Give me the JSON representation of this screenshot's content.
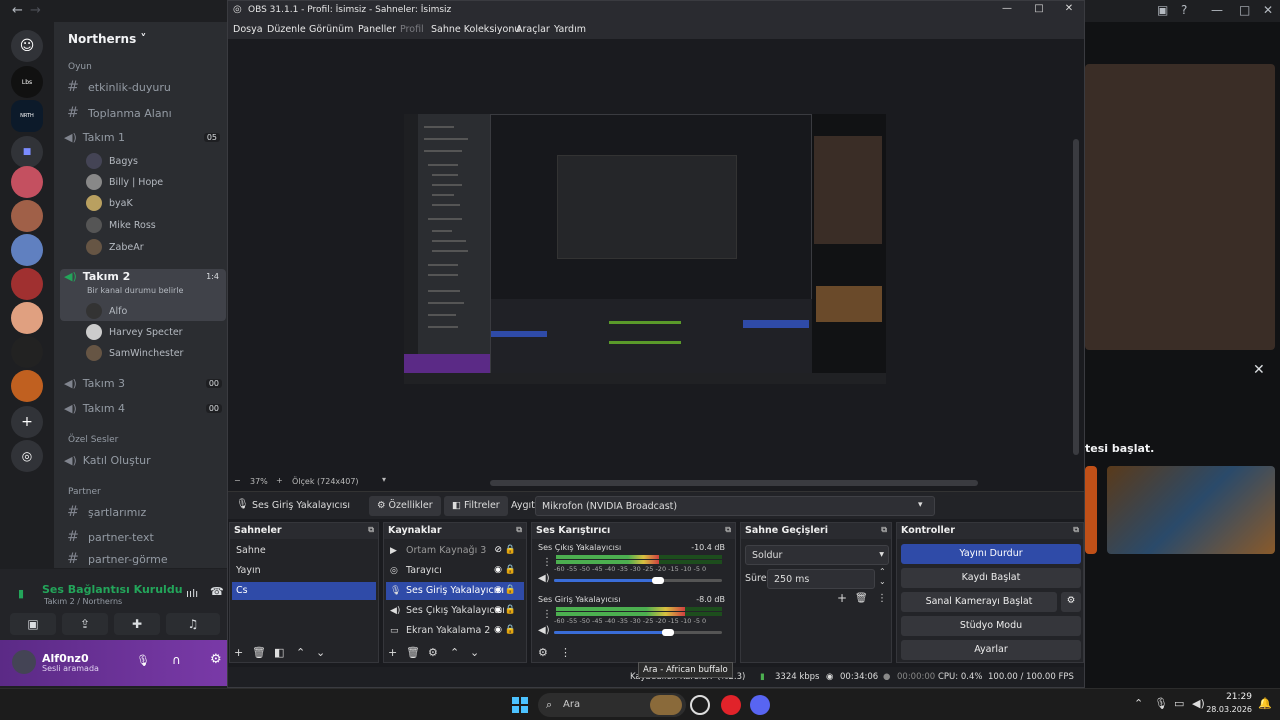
{
  "discord": {
    "server_name": "Northerns",
    "categories": {
      "oyun": "Oyun",
      "ozel_sesler": "Özel Sesler",
      "partner": "Partner"
    },
    "channels": {
      "etkinlik": "etkinlik-duyuru",
      "toplanma": "Toplanma Alanı",
      "takim1": "Takım 1",
      "takim2": "Takım 2",
      "takim2_status": "Bir kanal durumu belirle",
      "takim3": "Takım 3",
      "takim4": "Takım 4",
      "katil": "Katıl Oluştur",
      "sartlar": "şartlarımız",
      "partner_text": "partner-text",
      "partner_gorme": "partner-görme"
    },
    "badges": {
      "takim1": "05",
      "takim3": "00",
      "takim4": "00",
      "takim2_time": "1:4"
    },
    "takim1_users": [
      "Bagys",
      "Billy | Hope",
      "byaK",
      "Mike Ross",
      "ZabeAr"
    ],
    "takim2_users": [
      "Alfo",
      "Harvey Specter",
      "SamWinchester"
    ],
    "voice": {
      "status": "Ses Bağlantısı Kuruldu",
      "where": "Takım 2 / Northerns"
    },
    "user": {
      "name": "Alf0nz0",
      "status": "Sesli aramada"
    }
  },
  "right": {
    "text": "tesi başlat."
  },
  "obs": {
    "title": "OBS 31.1.1 - Profil: İsimsiz - Sahneler: İsimsiz",
    "menu": [
      "Dosya",
      "Düzenle",
      "Görünüm",
      "Paneller",
      "Profil",
      "Sahne Koleksiyonu",
      "Araçlar",
      "Yardım"
    ],
    "zoom": {
      "minus": "−",
      "value": "37%",
      "plus": "+",
      "scale": "Ölçek (724x407)"
    },
    "source_bar": {
      "name": "Ses Giriş Yakalayıcısı",
      "properties": "Özellikler",
      "filters": "Filtreler",
      "device_label": "Aygıt",
      "device_value": "Mikrofon (NVIDIA Broadcast)"
    },
    "scenes": {
      "title": "Sahneler",
      "items": [
        "Sahne",
        "Yayın",
        "Cs"
      ]
    },
    "sources": {
      "title": "Kaynaklar",
      "items": [
        "Ortam Kaynağı 3",
        "Tarayıcı",
        "Ses Giriş Yakalayıcısı",
        "Ses Çıkış Yakalayıcısı",
        "Ekran Yakalama 2"
      ]
    },
    "mixer": {
      "title": "Ses Karıştırıcı",
      "scale": "-60 -55 -50 -45 -40 -35 -30 -25 -20 -15 -10 -5 0",
      "channels": [
        {
          "name": "Ses Çıkış Yakalayıcısı",
          "db": "-10.4 dB",
          "level": 0.62,
          "volume": 0.62
        },
        {
          "name": "Ses Giriş Yakalayıcısı",
          "db": "-8.0 dB",
          "level": 0.78,
          "volume": 0.68
        }
      ]
    },
    "transitions": {
      "title": "Sahne Geçişleri",
      "type": "Soldur",
      "duration_label": "Süre",
      "duration": "250 ms"
    },
    "controls": {
      "title": "Kontroller",
      "stop_stream": "Yayını Durdur",
      "start_record": "Kaydı Başlat",
      "virtual_cam": "Sanal Kamerayı Başlat",
      "studio": "Stüdyo Modu",
      "settings": "Ayarlar"
    },
    "status": {
      "dropped": "Kaybedilen Kareler",
      "dropped_value": "7 (%2.3)",
      "bitrate": "3324 kbps",
      "stream_time": "00:34:06",
      "rec_time": "00:00:00",
      "cpu": "CPU: 0.4%",
      "fps": "100.00 / 100.00 FPS"
    },
    "tooltip": "Ara - African buffalo"
  },
  "taskbar": {
    "search": "Ara",
    "time": "21:29",
    "date": "28.03.2026"
  }
}
